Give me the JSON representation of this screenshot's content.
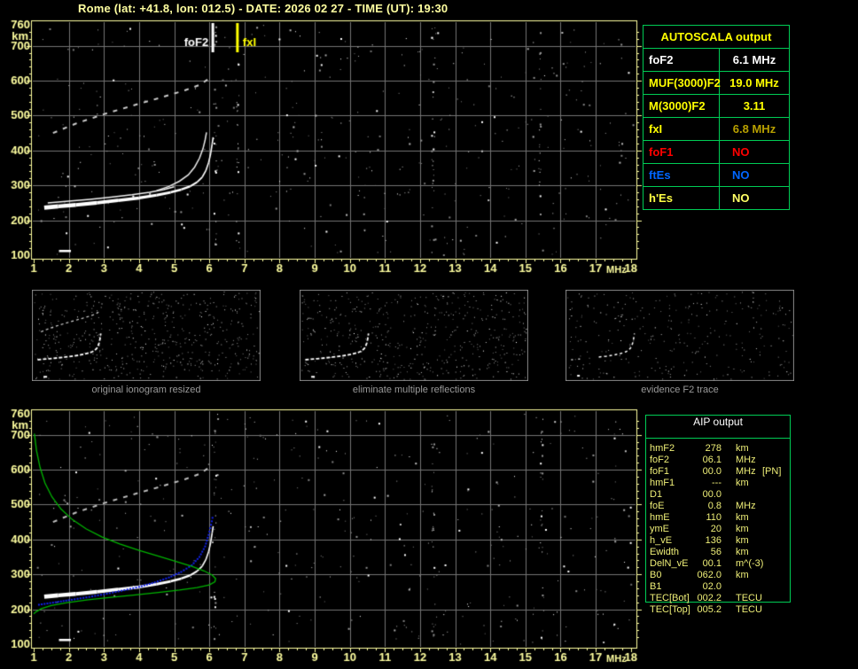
{
  "title": "Rome (lat: +41.8, lon: 012.5) - DATE: 2026 02 27 - TIME (UT): 19:30",
  "autoscala": {
    "title": "AUTOSCALA output",
    "rows": [
      {
        "label": "foF2",
        "value": "6.1 MHz",
        "label_color": "#ffffff",
        "value_color": "#ffffff"
      },
      {
        "label": "MUF(3000)F2",
        "value": "19.0 MHz",
        "label_color": "#ffff00",
        "value_color": "#ffff00"
      },
      {
        "label": "M(3000)F2",
        "value": "3.11",
        "label_color": "#ffff00",
        "value_color": "#ffff00"
      },
      {
        "label": "fxI",
        "value": "6.8 MHz",
        "label_color": "#ffff00",
        "value_color": "#b8a000"
      },
      {
        "label": "foF1",
        "value": "NO",
        "label_color": "#ff0000",
        "value_color": "#ff0000"
      },
      {
        "label": "ftEs",
        "value": "NO",
        "label_color": "#0066ff",
        "value_color": "#0066ff"
      },
      {
        "label": "h'Es",
        "value": "NO",
        "label_color": "#ffff44",
        "value_color": "#ffff66"
      }
    ]
  },
  "aip": {
    "title": "AIP output",
    "rows": [
      {
        "name": "hmF2",
        "value": "278",
        "unit": "km",
        "extra": ""
      },
      {
        "name": "foF2",
        "value": "06.1",
        "unit": "MHz",
        "extra": ""
      },
      {
        "name": "foF1",
        "value": "00.0",
        "unit": "MHz",
        "extra": "[PN]"
      },
      {
        "name": "hmF1",
        "value": "---",
        "unit": "km",
        "extra": ""
      },
      {
        "name": "D1",
        "value": "00.0",
        "unit": "",
        "extra": ""
      },
      {
        "name": "foE",
        "value": "0.8",
        "unit": "MHz",
        "extra": ""
      },
      {
        "name": "hmE",
        "value": "110",
        "unit": "km",
        "extra": ""
      },
      {
        "name": "ymE",
        "value": "20",
        "unit": "km",
        "extra": ""
      },
      {
        "name": "h_vE",
        "value": "136",
        "unit": "km",
        "extra": ""
      },
      {
        "name": "Ewidth",
        "value": "56",
        "unit": "km",
        "extra": ""
      },
      {
        "name": "DelN_vE",
        "value": "00.1",
        "unit": "m^(-3)",
        "extra": ""
      },
      {
        "name": "B0",
        "value": "062.0",
        "unit": "km",
        "extra": ""
      },
      {
        "name": "B1",
        "value": "02.0",
        "unit": "",
        "extra": ""
      },
      {
        "name": "TEC[Bot]",
        "value": "002.2",
        "unit": "TECU",
        "extra": ""
      },
      {
        "name": "TEC[Top]",
        "value": "005.2",
        "unit": "TECU",
        "extra": ""
      }
    ]
  },
  "thumbnails": [
    {
      "caption": "original ionogram resized"
    },
    {
      "caption": "eliminate multiple reflections"
    },
    {
      "caption": "evidence F2 trace"
    }
  ],
  "chart_data": {
    "type": "scatter",
    "xlabel": "MHz",
    "ylabel": "km",
    "xlim": [
      1,
      18
    ],
    "ylim": [
      100,
      760
    ],
    "xticks": [
      1,
      2,
      3,
      4,
      5,
      6,
      7,
      8,
      9,
      10,
      11,
      12,
      13,
      14,
      15,
      16,
      17,
      18
    ],
    "yticks": [
      100,
      200,
      300,
      400,
      500,
      600,
      700,
      760
    ],
    "grid": true,
    "colors": {
      "background": "#000000",
      "axis_yellow": "#ffffa0",
      "grid_gray": "#747474",
      "table_green": "#00cc55",
      "profile_green": "#00b400",
      "restored_blue": "#1122ee",
      "trace_white": "#ffffff",
      "caption_gray": "#9a9a9a"
    },
    "plots": [
      {
        "id": "scaled_ionogram",
        "markers": [
          {
            "label": "foF2",
            "f": 6.1,
            "color": "#ffffff",
            "align": "right"
          },
          {
            "label": "fxI",
            "f": 6.8,
            "color": "#ffff00",
            "align": "left"
          }
        ],
        "series": [
          {
            "name": "F2 trace measured",
            "color": "#ffffff",
            "style": "band",
            "points": [
              [
                1.3,
                236
              ],
              [
                1.7,
                240
              ],
              [
                2.2,
                244
              ],
              [
                2.8,
                250
              ],
              [
                3.4,
                257
              ],
              [
                4.0,
                264
              ],
              [
                4.5,
                272
              ],
              [
                4.9,
                280
              ],
              [
                5.2,
                288
              ],
              [
                5.45,
                297
              ],
              [
                5.65,
                309
              ],
              [
                5.8,
                324
              ],
              [
                5.9,
                342
              ],
              [
                5.98,
                365
              ],
              [
                6.04,
                392
              ],
              [
                6.08,
                418
              ],
              [
                6.11,
                438
              ]
            ]
          },
          {
            "name": "F2 x-mode band",
            "color": "#f2f2f2",
            "style": "thin",
            "points": [
              [
                1.4,
                250
              ],
              [
                2.0,
                255
              ],
              [
                2.6,
                260
              ],
              [
                3.2,
                266
              ],
              [
                3.8,
                273
              ],
              [
                4.3,
                280
              ],
              [
                4.7,
                288
              ],
              [
                5.0,
                296
              ]
            ]
          },
          {
            "name": "F2 o-mode asymptote",
            "color": "#e8e8e8",
            "style": "thin",
            "points": [
              [
                4.5,
                285
              ],
              [
                4.85,
                297
              ],
              [
                5.15,
                312
              ],
              [
                5.4,
                330
              ],
              [
                5.58,
                352
              ],
              [
                5.72,
                378
              ],
              [
                5.82,
                405
              ],
              [
                5.88,
                430
              ],
              [
                5.92,
                452
              ]
            ]
          },
          {
            "name": "second reflection",
            "color": "#cccccc",
            "style": "dash",
            "points": [
              [
                1.55,
                450
              ],
              [
                2.2,
                477
              ],
              [
                3.0,
                504
              ],
              [
                3.8,
                528
              ],
              [
                4.6,
                551
              ],
              [
                5.3,
                572
              ],
              [
                5.75,
                589
              ],
              [
                6.0,
                607
              ]
            ]
          },
          {
            "name": "Es remnant",
            "color": "#ffffff",
            "style": "band",
            "points": [
              [
                1.72,
                112
              ],
              [
                2.06,
                112
              ]
            ]
          }
        ],
        "noise": {
          "count": 430,
          "columns": [
            6.15,
            6.8,
            12.35,
            15.4
          ],
          "seed": 7
        }
      },
      {
        "id": "profile_ionogram",
        "markers": [],
        "series": [
          {
            "name": "F2 trace measured",
            "color": "#ffffff",
            "style": "band",
            "points": [
              [
                1.3,
                236
              ],
              [
                1.7,
                240
              ],
              [
                2.2,
                244
              ],
              [
                2.8,
                250
              ],
              [
                3.4,
                257
              ],
              [
                4.0,
                264
              ],
              [
                4.5,
                272
              ],
              [
                4.9,
                280
              ],
              [
                5.2,
                288
              ],
              [
                5.45,
                297
              ],
              [
                5.65,
                309
              ],
              [
                5.8,
                324
              ],
              [
                5.9,
                342
              ],
              [
                5.98,
                365
              ],
              [
                6.04,
                392
              ],
              [
                6.08,
                418
              ],
              [
                6.11,
                438
              ]
            ]
          },
          {
            "name": "second reflection",
            "color": "#bdbdbd",
            "style": "dash",
            "points": [
              [
                1.55,
                450
              ],
              [
                2.2,
                477
              ],
              [
                3.0,
                504
              ],
              [
                3.8,
                528
              ],
              [
                4.6,
                551
              ],
              [
                5.3,
                572
              ],
              [
                5.75,
                589
              ],
              [
                6.0,
                607
              ]
            ]
          },
          {
            "name": "Es remnant",
            "color": "#ffffff",
            "style": "band",
            "points": [
              [
                1.72,
                112
              ],
              [
                2.06,
                112
              ]
            ]
          },
          {
            "name": "restored trace",
            "color": "#1122ee",
            "style": "dots",
            "points": [
              [
                1.15,
                213
              ],
              [
                1.55,
                219
              ],
              [
                2.0,
                226
              ],
              [
                2.5,
                234
              ],
              [
                3.0,
                243
              ],
              [
                3.5,
                253
              ],
              [
                4.0,
                264
              ],
              [
                4.45,
                277
              ],
              [
                4.85,
                291
              ],
              [
                5.2,
                307
              ],
              [
                5.5,
                326
              ],
              [
                5.72,
                350
              ],
              [
                5.88,
                380
              ],
              [
                5.98,
                413
              ],
              [
                6.05,
                442
              ],
              [
                6.09,
                462
              ]
            ]
          },
          {
            "name": "electron density profile",
            "color": "#00b400",
            "style": "line",
            "points": [
              [
                1.02,
                703
              ],
              [
                1.08,
                655
              ],
              [
                1.18,
                607
              ],
              [
                1.32,
                562
              ],
              [
                1.52,
                522
              ],
              [
                1.78,
                487
              ],
              [
                2.1,
                457
              ],
              [
                2.5,
                430
              ],
              [
                2.95,
                407
              ],
              [
                3.45,
                387
              ],
              [
                4.0,
                369
              ],
              [
                4.55,
                352
              ],
              [
                5.05,
                337
              ],
              [
                5.5,
                323
              ],
              [
                5.85,
                310
              ],
              [
                6.08,
                298
              ],
              [
                6.18,
                288
              ],
              [
                6.16,
                279
              ],
              [
                6.0,
                270
              ],
              [
                5.65,
                262
              ],
              [
                5.15,
                255
              ],
              [
                4.55,
                248
              ],
              [
                3.9,
                241
              ],
              [
                3.2,
                234
              ],
              [
                2.55,
                227
              ],
              [
                1.95,
                219
              ],
              [
                1.5,
                211
              ],
              [
                1.22,
                202
              ],
              [
                1.07,
                193
              ],
              [
                1.0,
                187
              ]
            ]
          }
        ],
        "noise": {
          "count": 400,
          "columns": [
            6.15,
            12.35,
            15.45
          ],
          "seed": 13
        }
      }
    ],
    "thumbnails": [
      {
        "noise_count": 560,
        "show_trace": "full",
        "show_echo": true,
        "seed": 21
      },
      {
        "noise_count": 520,
        "show_trace": "full",
        "show_echo": false,
        "seed": 22
      },
      {
        "noise_count": 300,
        "show_trace": "partial",
        "show_echo": false,
        "seed": 23
      }
    ]
  }
}
